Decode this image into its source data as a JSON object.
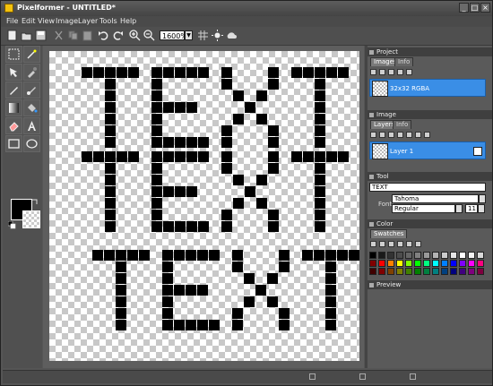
{
  "window": {
    "title": "Pixelformer - UNTITLED*"
  },
  "menu": [
    "File",
    "Edit",
    "View",
    "Image",
    "Layer",
    "Tools",
    "Help"
  ],
  "toolbar": {
    "zoom": "1600%"
  },
  "canvas": {
    "text_line1": "TEXT",
    "text_line2": "TEXT",
    "text_line3": "TEXT"
  },
  "panels": {
    "project": {
      "title": "Project",
      "tabs": [
        "Images",
        "Info"
      ],
      "image_item": "32x32 RGBA"
    },
    "image": {
      "title": "Image",
      "tabs": [
        "Layers",
        "Info"
      ],
      "layer_item": "Layer 1"
    },
    "tool": {
      "title": "Tool",
      "text_value": "TEXT",
      "font_label": "Font:",
      "font_name": "Tahoma",
      "font_style": "Regular",
      "font_size": "11"
    },
    "color": {
      "title": "Color",
      "tabs": [
        "Swatches"
      ]
    },
    "preview": {
      "title": "Preview"
    }
  },
  "colors": {
    "accent": "#3a8ee6",
    "swatches_row1": [
      "#000000",
      "#1a1a1a",
      "#333333",
      "#4d4d4d",
      "#666666",
      "#808080",
      "#999999",
      "#b3b3b3",
      "#cccccc",
      "#e6e6e6",
      "#ffffff",
      "#f2f2f2",
      "#d9d9d9"
    ],
    "swatches_row2": [
      "#800000",
      "#ff0000",
      "#ff8000",
      "#ffff00",
      "#80ff00",
      "#00ff00",
      "#00ff80",
      "#00ffff",
      "#0080ff",
      "#0000ff",
      "#8000ff",
      "#ff00ff",
      "#ff0080"
    ],
    "swatches_row3": [
      "#400000",
      "#800000",
      "#804000",
      "#808000",
      "#408000",
      "#008000",
      "#008040",
      "#008080",
      "#004080",
      "#000080",
      "#400080",
      "#800080",
      "#800040"
    ]
  }
}
